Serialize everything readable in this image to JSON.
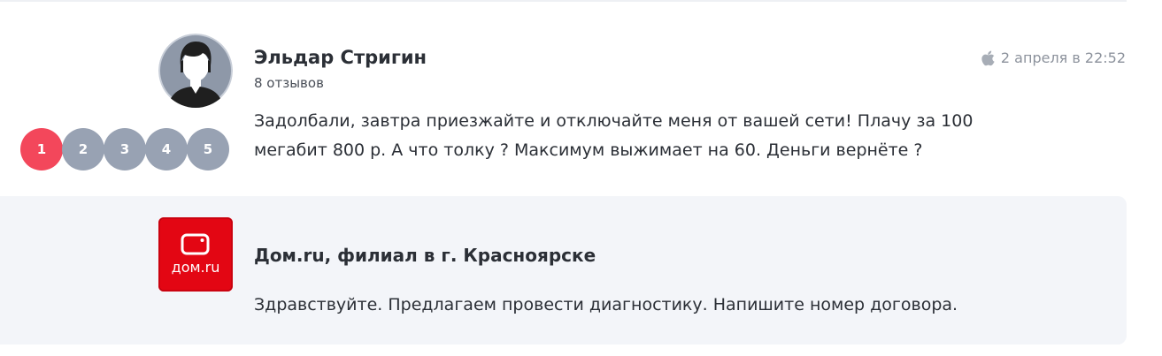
{
  "review": {
    "author_name": "Эльдар Стригин",
    "author_reviews": "8 отзывов",
    "date": "2 апреля в 22:52",
    "platform_icon": "apple-icon",
    "text": "Задолбали, завтра приезжайте и отключайте меня от вашей сети! Плачу за 100 мегабит 800 р. А что толку ? Максимум выжимает на 60. Деньги вернёте ?",
    "rating_options": [
      "1",
      "2",
      "3",
      "4",
      "5"
    ],
    "selected_rating": "1"
  },
  "reply": {
    "company_name": "Дом.ru, филиал в г. Красноярске",
    "logo_text": "дом.ru",
    "text": "Здравствуйте. Предлагаем провести диагностику. Напишите номер договора."
  },
  "colors": {
    "rating_active": "#f3475b",
    "rating_inactive": "#98a2b3",
    "brand_red": "#e30613",
    "reply_background": "#f3f5f9"
  }
}
